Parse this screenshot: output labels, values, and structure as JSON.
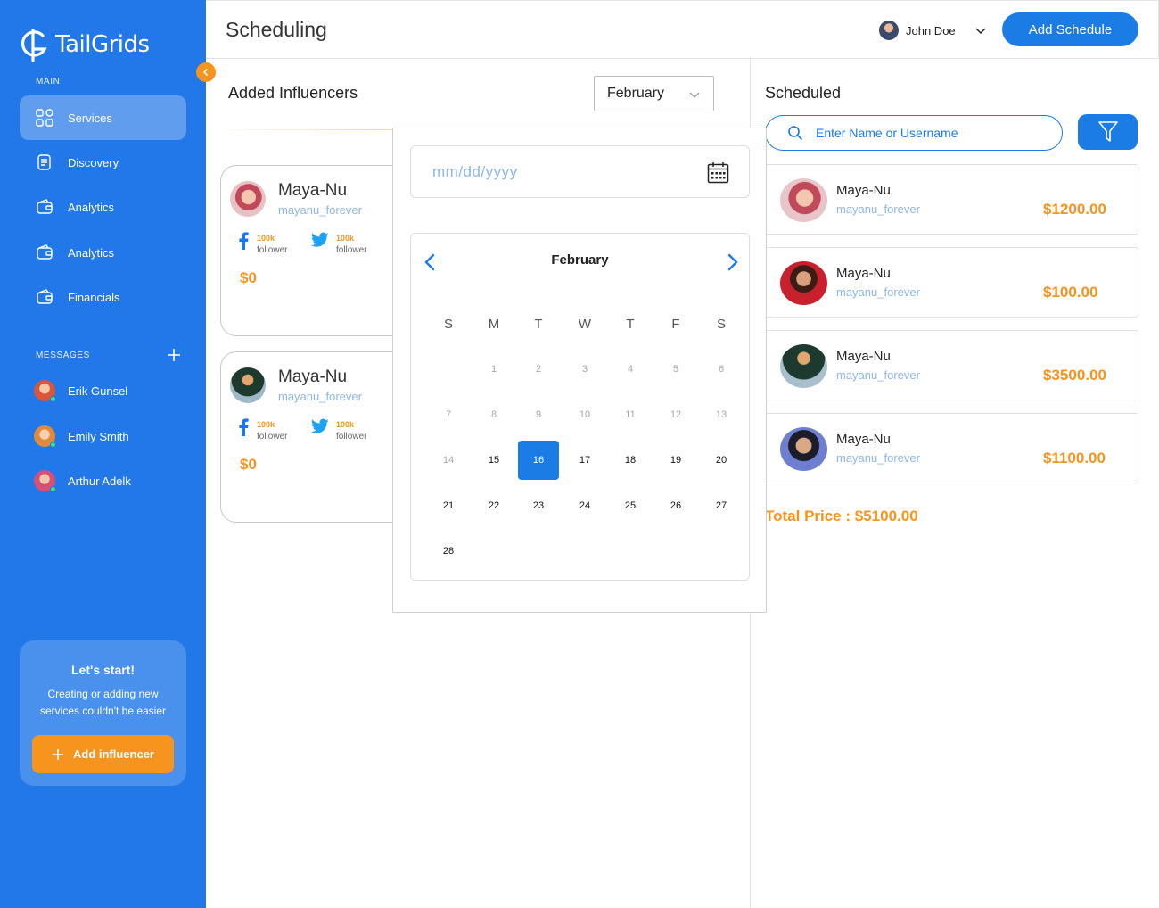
{
  "brand": {
    "name": "TailGrids",
    "accent": "#2378E9",
    "orange": "#F7941D"
  },
  "sidebar": {
    "main_label": "MAIN",
    "items": [
      {
        "label": "Services",
        "icon": "grid-icon",
        "active": true
      },
      {
        "label": "Discovery",
        "icon": "document-icon"
      },
      {
        "label": "Analytics",
        "icon": "wallet-icon"
      },
      {
        "label": "Analytics",
        "icon": "wallet-icon"
      },
      {
        "label": "Financials",
        "icon": "wallet-icon"
      }
    ],
    "messages_label": "MESSAGES",
    "messages": [
      {
        "name": "Erik Gunsel"
      },
      {
        "name": "Emily Smith"
      },
      {
        "name": "Arthur Adelk"
      }
    ],
    "promo": {
      "title": "Let's start!",
      "text": "Creating or adding new services couldn't be easier",
      "button": "Add influencer"
    }
  },
  "header": {
    "title": "Scheduling",
    "user_name": "John Doe",
    "add_button": "Add Schedule"
  },
  "influencers": {
    "title": "Added Influencers",
    "month_select": "February",
    "cards": [
      {
        "name": "Maya-Nu",
        "username": "mayanu_forever",
        "price": "$0",
        "stats": [
          {
            "network": "facebook",
            "count": "100k",
            "label": "follower"
          },
          {
            "network": "twitter",
            "count": "100k",
            "label": "follower"
          }
        ]
      },
      {
        "name": "Maya-Nu",
        "username": "mayanu_forever",
        "price": "$0",
        "stats": [
          {
            "network": "facebook",
            "count": "100k",
            "label": "follower"
          },
          {
            "network": "twitter",
            "count": "100k",
            "label": "follower"
          }
        ]
      }
    ]
  },
  "datepicker": {
    "placeholder": "mm/dd/yyyy",
    "month": "February",
    "weekdays": [
      "S",
      "M",
      "T",
      "W",
      "T",
      "F",
      "S"
    ],
    "weeks": [
      [
        "",
        "1",
        "2",
        "3",
        "4",
        "5",
        "6"
      ],
      [
        "7",
        "8",
        "9",
        "10",
        "11",
        "12",
        "13"
      ],
      [
        "14",
        "15",
        "16",
        "17",
        "18",
        "19",
        "20"
      ],
      [
        "21",
        "22",
        "23",
        "24",
        "25",
        "26",
        "27"
      ],
      [
        "28",
        "",
        "",
        "",
        "",
        "",
        ""
      ]
    ],
    "selected": "16",
    "muted_until": 15
  },
  "scheduled": {
    "title": "Scheduled",
    "search_placeholder": "Enter Name or Username",
    "items": [
      {
        "name": "Maya-Nu",
        "username": "mayanu_forever",
        "price": "$1200.00"
      },
      {
        "name": "Maya-Nu",
        "username": "mayanu_forever",
        "price": "$100.00"
      },
      {
        "name": "Maya-Nu",
        "username": "mayanu_forever",
        "price": "$3500.00"
      },
      {
        "name": "Maya-Nu",
        "username": "mayanu_forever",
        "price": "$1100.00"
      }
    ],
    "total": "Total Price : $5100.00"
  }
}
